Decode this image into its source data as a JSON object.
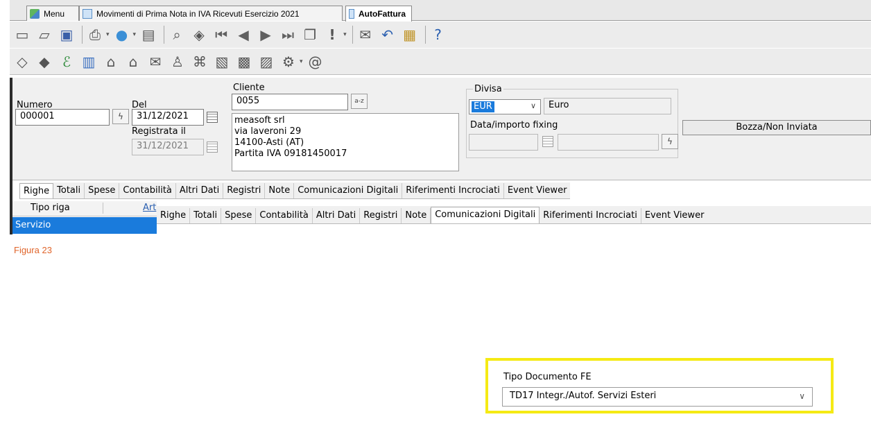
{
  "tabs": {
    "menu": "Menu",
    "movimenti": "Movimenti di Prima Nota in IVA Ricevuti Esercizio 2021",
    "autofattura": "AutoFattura"
  },
  "header": {
    "numero_label": "Numero",
    "numero_value": "000001",
    "del_label": "Del",
    "del_value": "31/12/2021",
    "registrata_label": "Registrata il",
    "registrata_value": "31/12/2021",
    "cliente_label": "Cliente",
    "cliente_value": "0055",
    "cliente_search_btn": "a-z",
    "address": [
      "measoft srl",
      "via laveroni 29",
      "14100-Asti (AT)",
      "Partita IVA 09181450017"
    ],
    "divisa_label": "Divisa",
    "divisa_value": "EUR",
    "divisa_desc": "Euro",
    "fixing_label": "Data/importo fixing",
    "status": "Bozza/Non Inviata"
  },
  "tabs_row": [
    "Righe",
    "Totali",
    "Spese",
    "Contabilità",
    "Altri Dati",
    "Registri",
    "Note",
    "Comunicazioni Digitali",
    "Riferimenti Incrociati",
    "Event Viewer"
  ],
  "grid": {
    "col_tipo": "Tipo riga",
    "col_art": "Art",
    "row_value": "Servizio"
  },
  "figure_caption": "Figura 23",
  "fe": {
    "label": "Tipo Documento FE",
    "value": "TD17 Integr./Autof. Servizi Esteri"
  },
  "colors": {
    "selection": "#1a7bdc",
    "highlight_border": "#f5ea14",
    "caption": "#e0652b"
  }
}
